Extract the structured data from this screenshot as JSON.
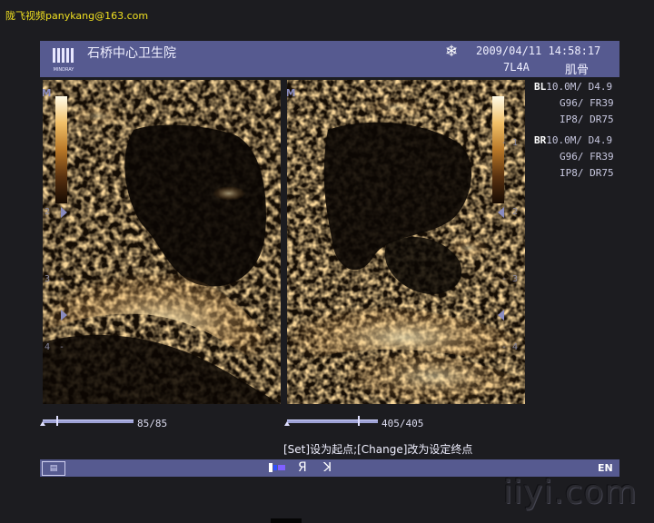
{
  "watermark_top": "陇飞视频panykang@163.com",
  "header": {
    "hospital": "石桥中心卫生院",
    "logo_text": "MINDRAY",
    "datetime": "2009/04/11  14:58:17",
    "probe": "7L4A",
    "preset": "肌骨"
  },
  "params": {
    "bl": {
      "tag": "BL",
      "l1": "10.0M/ D4.9",
      "l2": "G96/ FR39",
      "l3": "IP8/ DR75"
    },
    "br": {
      "tag": "BR",
      "l1": "10.0M/ D4.9",
      "l2": "G96/ FR39",
      "l3": "IP8/ DR75"
    }
  },
  "depth_scale": {
    "left": [
      "2",
      "3",
      "4"
    ],
    "right": [
      "1",
      "2",
      "3",
      "4"
    ]
  },
  "cine": {
    "left": {
      "count": "85/85",
      "position": 0.15
    },
    "right": {
      "count": "405/405",
      "position": 0.8
    }
  },
  "hint": "[Set]设为起点;[Change]改为设定终点",
  "statusbar": {
    "lang": "EN",
    "icons": [
      "cine-icon",
      "r-mirror-icon",
      "b-mirror-icon"
    ]
  },
  "watermark_bottom": "iiyi.com",
  "colors": {
    "bar": "#565a90",
    "background": "#1c1c20",
    "tint": "#f0c070"
  }
}
